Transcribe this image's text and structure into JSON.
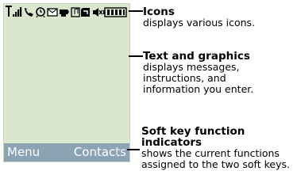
{
  "screen": {
    "status_icons": [
      "signal-strength-icon",
      "call-icon",
      "alarm-icon",
      "message-icon",
      "browser-icon",
      "music-icon",
      "memory-card-icon",
      "silent-icon",
      "battery-icon"
    ],
    "softkeys": {
      "left": "Menu",
      "right": "Contacts"
    }
  },
  "callouts": [
    {
      "title": "Icons",
      "description": "displays various icons."
    },
    {
      "title": "Text and graphics",
      "description": "displays messages, instructions, and information you enter."
    },
    {
      "title": "Soft key function indicators",
      "description": "shows the current functions assigned to the two soft keys."
    }
  ]
}
